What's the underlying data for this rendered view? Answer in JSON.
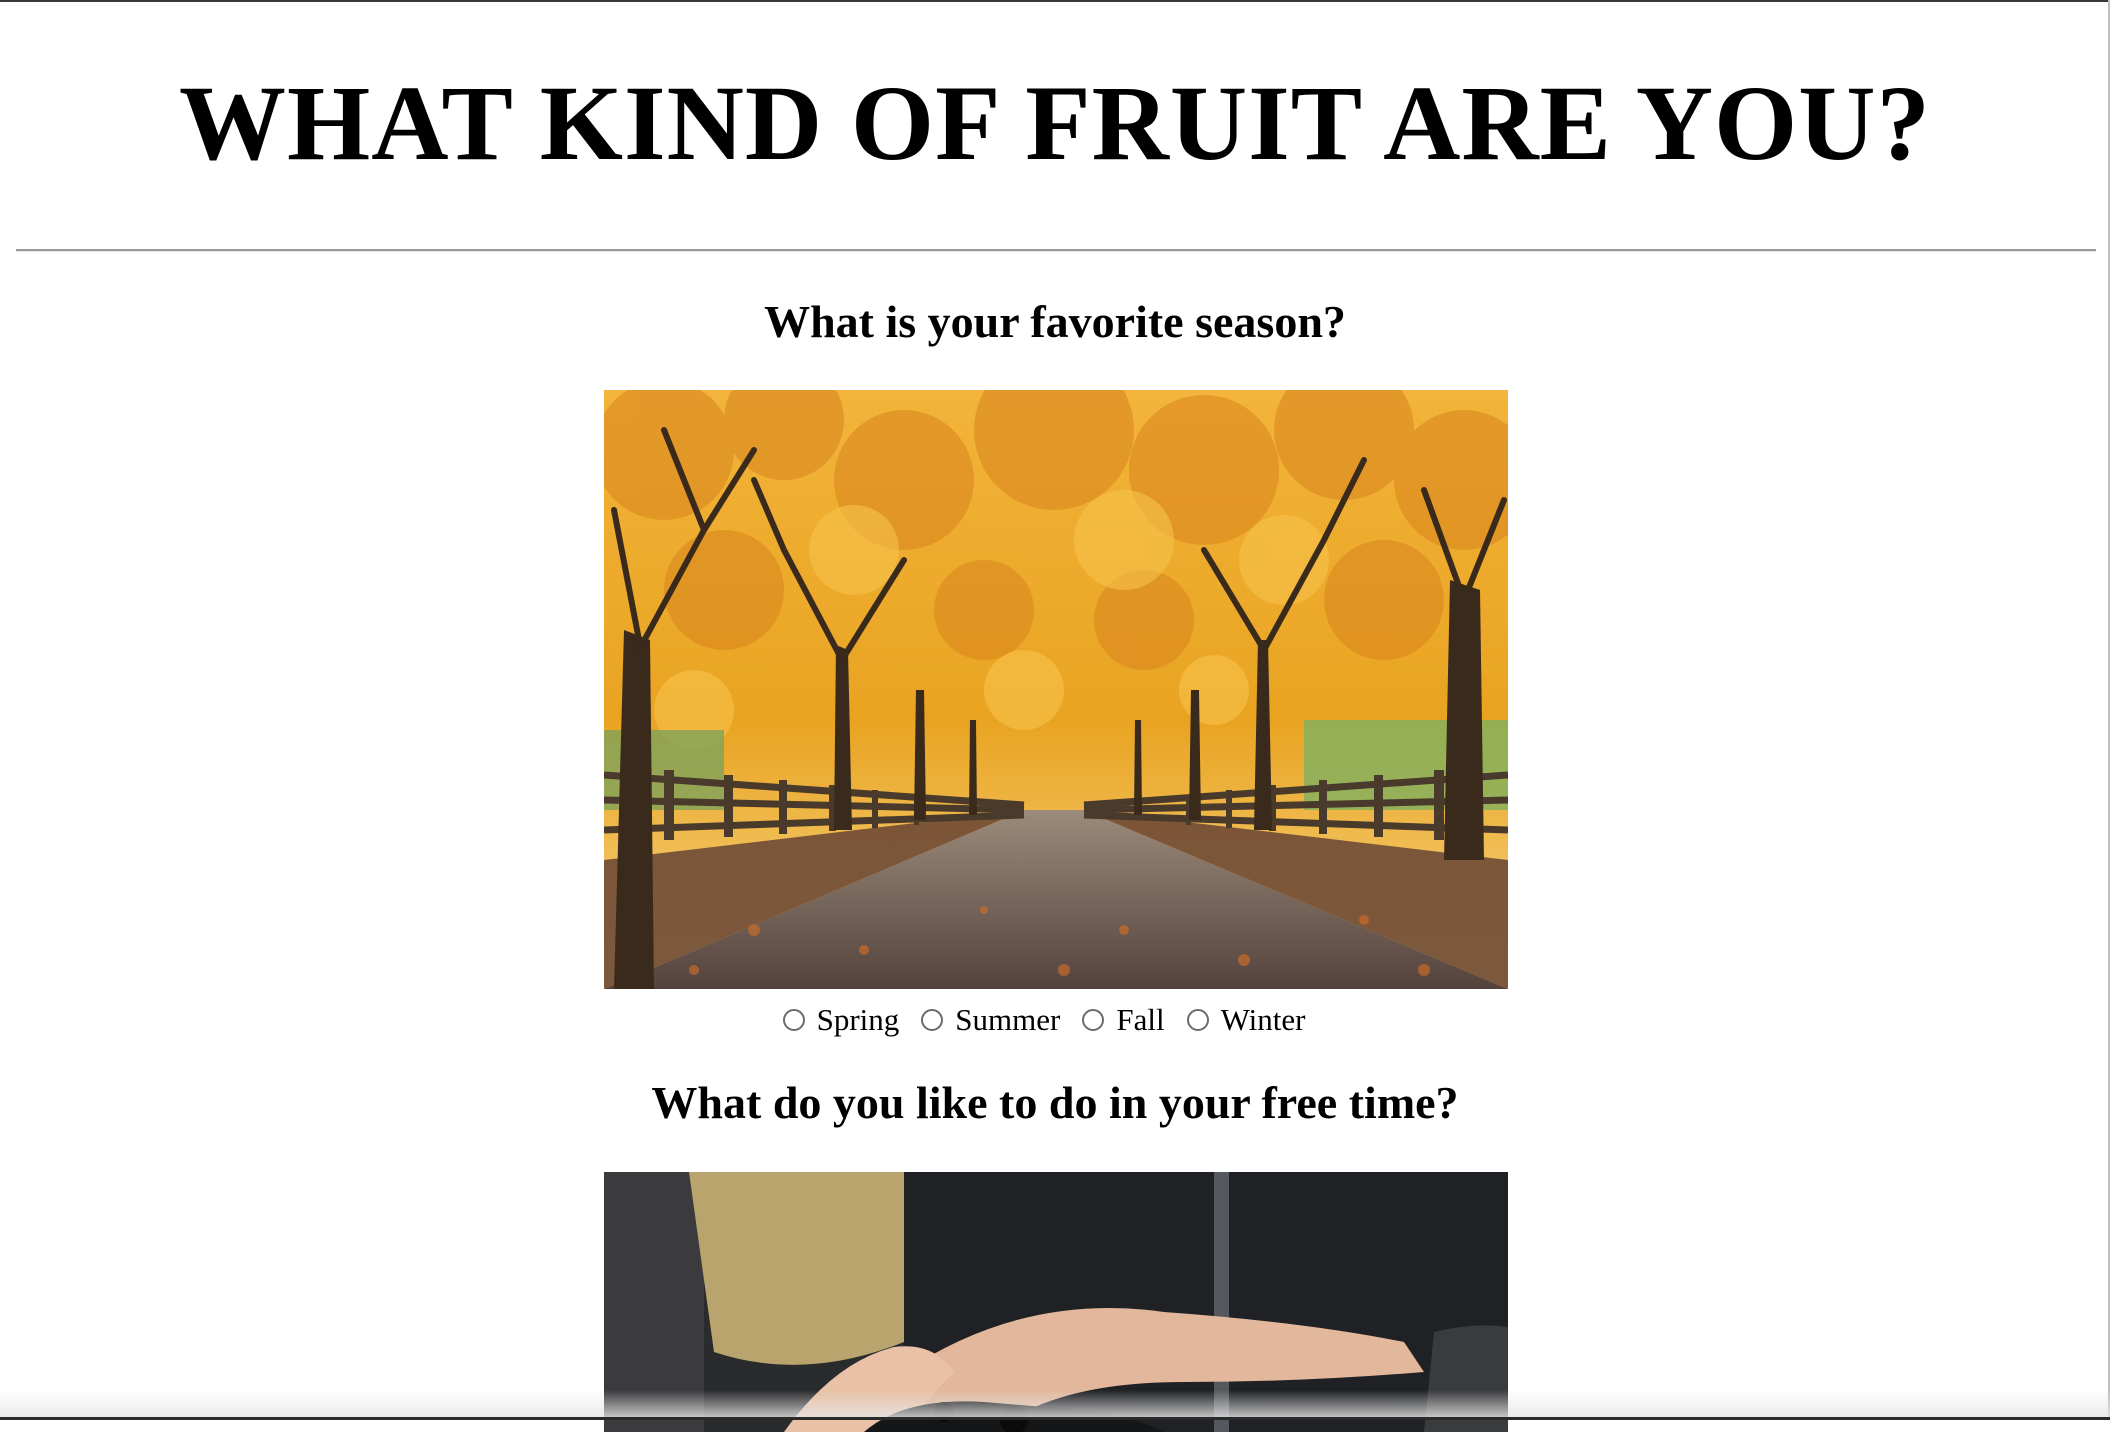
{
  "page": {
    "title": "WHAT KIND OF FRUIT ARE YOU?"
  },
  "questions": [
    {
      "heading": "What is your favorite season?",
      "image_icon": "autumn-tree-lined-road-photo",
      "options": [
        "Spring",
        "Summer",
        "Fall",
        "Winter"
      ],
      "selected": null
    },
    {
      "heading": "What do you like to do in your free time?",
      "image_icon": "hands-holding-game-controller-photo"
    }
  ],
  "colors": {
    "foliage": "#e9a321",
    "foliage_dark": "#c9751b",
    "trunk": "#3a2a1c",
    "road": "#6d5a55",
    "fence": "#4a3a2c",
    "sweater": "#1f2124",
    "cushion": "#b8a46c",
    "skin": "#e2b79c"
  }
}
